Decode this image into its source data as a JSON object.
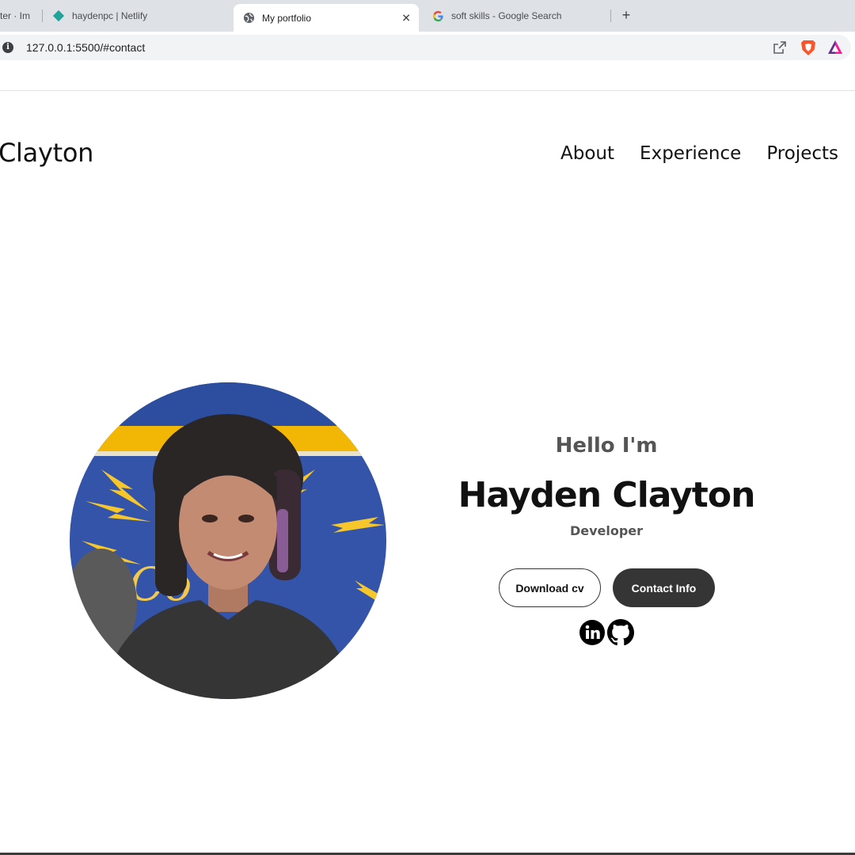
{
  "browser": {
    "tabs": [
      {
        "label": "ter · Im",
        "active": false
      },
      {
        "label": "haydenpc | Netlify",
        "active": false
      },
      {
        "label": "My portfolio",
        "active": true
      },
      {
        "label": "soft skills - Google Search",
        "active": false
      }
    ],
    "close_glyph": "✕",
    "new_tab_glyph": "+",
    "site_info_glyph": "i",
    "url": "127.0.0.1:5500/#contact",
    "icons": [
      "share-icon",
      "brave-shields-icon",
      "brave-rewards-icon",
      "netlify-icon",
      "globe-icon",
      "google-icon"
    ],
    "colors": {
      "tabstrip": "#dee1e6",
      "omnibox": "#f1f3f4",
      "netlify": "#20a39a",
      "brave": "#fb542b"
    }
  },
  "site": {
    "brand": "Clayton",
    "nav": [
      "About",
      "Experience",
      "Projects"
    ],
    "hero": {
      "greeting": "Hello I'm",
      "name": "Hayden Clayton",
      "role": "Developer",
      "buttons": {
        "download": "Download cv",
        "contact": "Contact Info"
      },
      "social": [
        "linkedin-icon",
        "github-icon"
      ]
    },
    "colors": {
      "text": "#111111",
      "muted": "#555555",
      "button_dark": "#353535"
    }
  }
}
